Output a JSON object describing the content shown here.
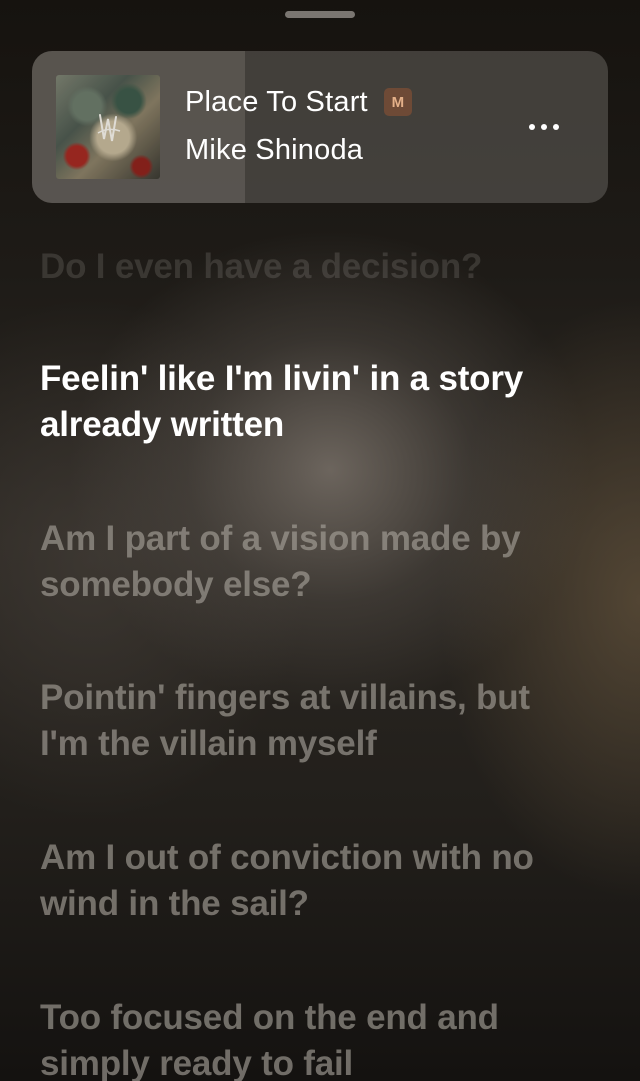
{
  "now_playing": {
    "title": "Place To Start",
    "explicit_badge": "M",
    "artist": "Mike Shinoda",
    "progress_fraction": 0.37,
    "more_icon": "more-horizontal-icon",
    "artwork_icon": "album-artwork"
  },
  "lyrics": {
    "lines": [
      {
        "text": "Do I even have a decision?",
        "state": "past"
      },
      {
        "text": "Feelin' like I'm livin' in a story already written",
        "state": "current"
      },
      {
        "text": "Am I part of a vision made by somebody else?",
        "state": "upcoming"
      },
      {
        "text": "Pointin' fingers at villains, but I'm the villain myself",
        "state": "upcoming"
      },
      {
        "text": "Am I out of conviction with no wind in the sail?",
        "state": "upcoming"
      },
      {
        "text": "Too focused on the end and simply ready to fail",
        "state": "upcoming"
      }
    ]
  },
  "colors": {
    "current_lyric": "#ffffff",
    "explicit_badge_bg": "#6e4a36",
    "explicit_badge_text": "#e4b089"
  }
}
